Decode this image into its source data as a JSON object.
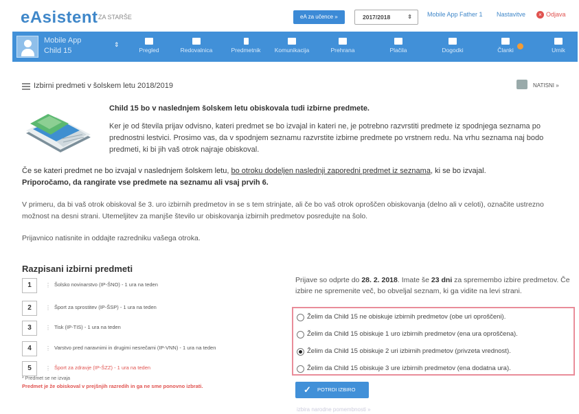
{
  "header": {
    "logo": "eAsistent",
    "logo_sub": "ZA STARŠE",
    "student_button": "eA za učence »",
    "year": "2017/2018",
    "user": "Mobile App Father 1",
    "settings": "Nastavitve",
    "logout": "Odjava"
  },
  "nav": {
    "child_line1": "Mobile App",
    "child_line2": "Child 15",
    "items": [
      {
        "label": "Pregled",
        "icon": "overview-icon"
      },
      {
        "label": "Redovalnica",
        "icon": "gradebook-icon"
      },
      {
        "label": "Predmetnik",
        "icon": "subjects-icon"
      },
      {
        "label": "Komunikacija",
        "icon": "chat-icon"
      },
      {
        "label": "Prehrana",
        "icon": "food-icon"
      },
      {
        "label": "Plačila",
        "icon": "payments-icon"
      },
      {
        "label": "Dogodki",
        "icon": "events-icon"
      },
      {
        "label": "Članki",
        "icon": "articles-icon"
      },
      {
        "label": "Urnik",
        "icon": "schedule-icon"
      }
    ]
  },
  "page": {
    "section_title": "Izbirni predmeti v šolskem letu 2018/2019",
    "print": "NATISNI »",
    "intro_title": "Child 15 bo v naslednjem šolskem letu obiskovala tudi izbirne predmete.",
    "intro_text": "Ker je od števila prijav odvisno, kateri predmet se bo izvajal in kateri ne, je potrebno razvrstiti predmete iz spodnjega seznama po prednostni lestvici. Prosimo vas, da v spodnjem seznamu razvrstite izbirne predmete po vrstnem redu. Na vrhu seznama naj bodo predmeti, ki bi jih vaš otrok najraje obiskoval.",
    "p1_a": "Če se kateri predmet ne bo izvajal v naslednjem šolskem letu, ",
    "p1_link": "bo otroku dodeljen naslednji zaporedni predmet iz seznama",
    "p1_b": ", ki se bo izvajal.",
    "p1_bold": "Priporočamo, da rangirate vse predmete na seznamu ali vsaj prvih 6.",
    "p2": "V primeru, da bi vaš otrok obiskoval še 3. uro izbirnih predmetov in se s tem strinjate, ali če bo vaš otrok oproščen obiskovanja (delno ali v celoti), označite ustrezno možnost na desni strani. Utemeljitev za manjše število ur obiskovanja izbirnih predmetov posredujte na šolo.",
    "p3": "Prijavnico natisnite in oddajte razredniku vašega otroka."
  },
  "subjects": {
    "title": "Razpisani izbirni predmeti",
    "items": [
      {
        "num": "1",
        "text": "Šolsko novinarstvo (IP-ŠNO) - 1 ura na teden"
      },
      {
        "num": "2",
        "text": "Šport za sprostitev (IP-ŠSP) - 1 ura na teden"
      },
      {
        "num": "3",
        "text": "Tisk (IP-TIS) - 1 ura na teden"
      },
      {
        "num": "4",
        "text": "Varstvo pred naravnimi in drugimi nesrečami (IP-VNN) - 1 ura na teden"
      },
      {
        "num": "5",
        "text": "Šport za zdravje (IP-ŠZZ) - 1 ura na teden"
      }
    ],
    "note1": "* Predmet se ne izvaja",
    "note2": "Predmet je že obiskoval v prejšnjih razredih in ga ne sme ponovno izbrati."
  },
  "deadline": {
    "a": "Prijave so odprte do ",
    "date": "28. 2. 2018",
    "b": ". Imate še ",
    "days": "23 dni",
    "c": " za spremembo izbire predmetov. Če izbire ne spremenite več, bo obveljal seznam, ki ga vidite na levi strani."
  },
  "options": [
    {
      "text": "Želim da Child 15 ne obiskuje izbirnih predmetov (obe uri oproščeni).",
      "selected": false
    },
    {
      "text": "Želim da Child 15 obiskuje 1 uro izbirnih predmetov (ena ura oproščena).",
      "selected": false
    },
    {
      "text": "Želim da Child 15 obiskuje 2 uri izbirnih predmetov (privzeta vrednost).",
      "selected": true
    },
    {
      "text": "Želim da Child 15 obiskuje 3 ure izbirnih predmetov (ena dodatna ura).",
      "selected": false
    }
  ],
  "confirm_button": "POTRDI IZBIRO",
  "faded_link": "izbira narodne pomembnosti »"
}
